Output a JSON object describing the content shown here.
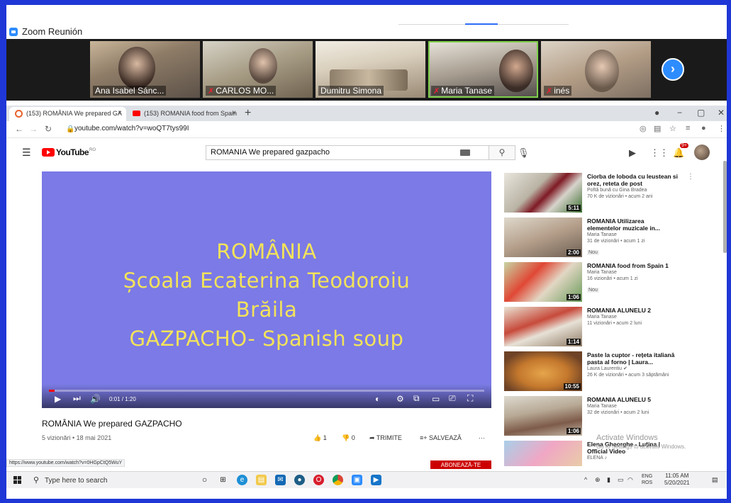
{
  "zoom": {
    "title": "Zoom Reunión",
    "participants": [
      {
        "name": "Ana Isabel Sánc...",
        "muted": false
      },
      {
        "name": "CARLOS MO...",
        "muted": true
      },
      {
        "name": "Dumitru Simona",
        "muted": false
      },
      {
        "name": "Maria Tanase",
        "muted": true
      },
      {
        "name": "inés",
        "muted": true
      }
    ],
    "next_glyph": "›"
  },
  "browser": {
    "tabs": [
      {
        "label": "(153) ROMÂNIA We prepared GA",
        "close": "×"
      },
      {
        "label": "(153) ROMANIA food from Spain",
        "close": "×"
      }
    ],
    "new_tab": "+",
    "url": "youtube.com/watch?v=woQT7tys99I",
    "status_url": "https://www.youtube.com/watch?v=0HGpCtQ5WuY"
  },
  "youtube": {
    "logo": "YouTube",
    "region": "RO",
    "search_value": "ROMANIA We prepared gazpacho",
    "notifications": "9+",
    "video": {
      "lines": [
        "ROMÂNIA",
        "Școala Ecaterina Teodoroiu",
        "Brăila",
        "GAZPACHO- Spanish soup"
      ],
      "time": "0:01 / 1:20",
      "progress": 0.013,
      "title": "ROMÂNIA We prepared GAZPACHO",
      "meta": "5 vizionări • 18 mai 2021",
      "likes": "1",
      "dislikes": "0",
      "share": "TRIMITE",
      "save": "SALVEAZĂ",
      "more": "···",
      "subscribe": "ABONEAZĂ-TE"
    },
    "recommendations": [
      {
        "title": "Ciorba de loboda cu leustean si orez, reteta de post",
        "channel": "Poftă bună cu Gina Bradea",
        "meta": "70 K de vizionări • acum 2 ani",
        "duration": "5:11",
        "badge": ""
      },
      {
        "title": "ROMANIA Utilizarea elementelor muzicale in...",
        "channel": "Maria Tanase",
        "meta": "31 de vizionări • acum 1 zi",
        "duration": "2:00",
        "badge": "Nou"
      },
      {
        "title": "ROMANIA food from Spain 1",
        "channel": "Maria Tanase",
        "meta": "16 vizionări • acum 1 zi",
        "duration": "1:06",
        "badge": "Nou"
      },
      {
        "title": "ROMANIA ALUNELU 2",
        "channel": "Maria Tanase",
        "meta": "11 vizionări • acum 2 luni",
        "duration": "1:14",
        "badge": ""
      },
      {
        "title": "Paste la cuptor - rețeta italiană pasta al forno | Laura...",
        "channel": "Laura Laurentiu",
        "meta": "26 K de vizionări • acum 3 săptămâni",
        "duration": "10:55",
        "badge": ""
      },
      {
        "title": "ROMANIA ALUNELU 5",
        "channel": "Maria Tanase",
        "meta": "32 de vizionări • acum 2 luni",
        "duration": "1:06",
        "badge": ""
      },
      {
        "title": "Elena Gheorghe - Luțina | Official Video",
        "channel": "ELENA",
        "meta": "",
        "duration": "",
        "badge": ""
      }
    ]
  },
  "watermark": {
    "line1": "Activate Windows",
    "line2": "Go to Settings to activate Windows."
  },
  "taskbar": {
    "search_placeholder": "Type here to search",
    "lang1": "ENG",
    "lang2": "ROS",
    "time": "11:05 AM",
    "date": "5/20/2021"
  },
  "colors": {
    "zoom_blue": "#2d8cff",
    "youtube_red": "#ff0000",
    "frame_blue": "#1f37d6",
    "video_bg": "#7b7ae6",
    "video_text": "#f3e35a"
  }
}
